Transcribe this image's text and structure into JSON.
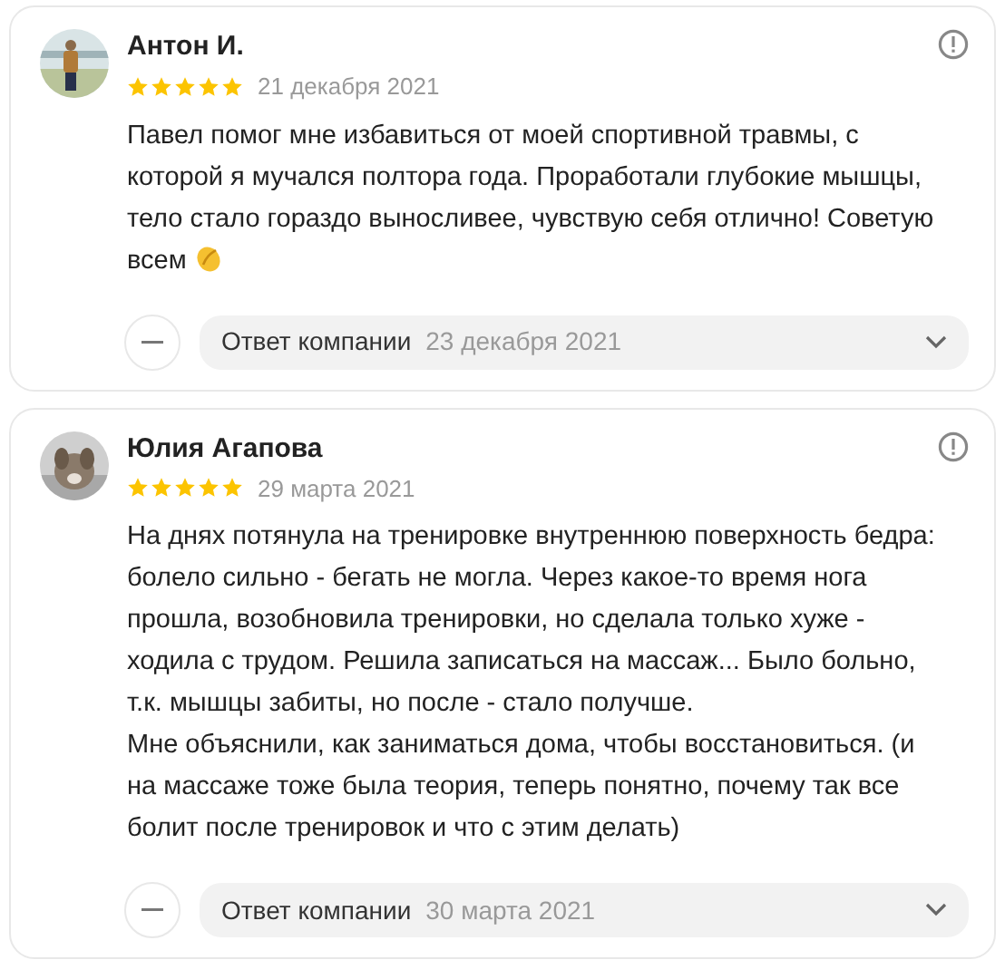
{
  "reviews": [
    {
      "author": "Антон И.",
      "stars": 5,
      "date": "21 декабря 2021",
      "text": "Павел помог мне избавиться от моей спортивной травмы, с которой я мучался полтора года. Проработали глубокие мышцы, тело стало гораздо выносливее, чувствую себя отлично! Советую всем",
      "reply": {
        "label": "Ответ компании",
        "date": "23 декабря 2021",
        "expanded": false
      }
    },
    {
      "author": "Юлия Агапова",
      "stars": 5,
      "date": "29 марта 2021",
      "text": "На днях потянула на тренировке внутреннюю поверхность бедра: болело сильно - бегать не могла. Через какое-то время нога прошла, возобновила тренировки, но сделала только хуже - ходила с трудом. Решила записаться на массаж... Было больно, т.к. мышцы забиты, но после - стало получше.\nМне объяснили, как заниматься дома, чтобы восстановиться. (и на массаже тоже была теория, теперь понятно, почему так все болит после тренировок и что с этим делать)",
      "reply": {
        "label": "Ответ компании",
        "date": "30 марта 2021",
        "expanded": false
      }
    }
  ]
}
